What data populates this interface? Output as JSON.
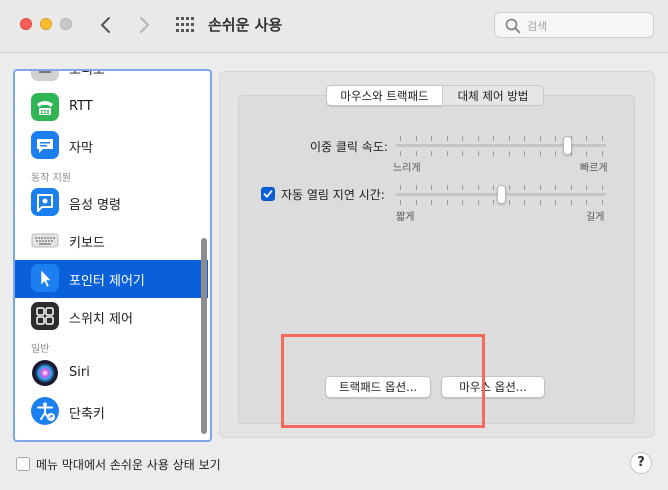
{
  "window": {
    "title": "손쉬운 사용"
  },
  "search": {
    "placeholder": "검색"
  },
  "sidebar": {
    "partial_top_label": "오디오",
    "items": [
      {
        "label": "RTT",
        "icon": "rtt-phone-icon",
        "color": "#2fb553"
      },
      {
        "label": "자막",
        "icon": "captions-icon",
        "color": "#1c7ff0"
      },
      {
        "header": "동작 지원"
      },
      {
        "label": "음성 명령",
        "icon": "voice-control-icon",
        "color": "#1c7ff0"
      },
      {
        "label": "키보드",
        "icon": "keyboard-icon",
        "color": "#d9d9d9"
      },
      {
        "label": "포인터 제어기",
        "icon": "pointer-control-icon",
        "color": "#1c7ff0",
        "selected": true
      },
      {
        "label": "스위치 제어",
        "icon": "switch-control-icon",
        "color": "#2c2c2e"
      },
      {
        "header": "일반"
      },
      {
        "label": "Siri",
        "icon": "siri-icon",
        "color": "#1a1a2e"
      },
      {
        "label": "단축키",
        "icon": "accessibility-shortcut-icon",
        "color": "#1c7ff0"
      }
    ]
  },
  "tabs": [
    {
      "label": "마우스와 트랙패드",
      "active": true
    },
    {
      "label": "대체 제어 방법",
      "active": false
    }
  ],
  "settings": {
    "double_click": {
      "label": "이중 클릭 속도:",
      "min_label": "느리게",
      "max_label": "빠르게",
      "value": 0.83
    },
    "spring_loading": {
      "label": "자동 열림 지연 시간:",
      "checked": true,
      "min_label": "짧게",
      "max_label": "길게",
      "value": 0.5
    }
  },
  "buttons": {
    "trackpad_options": "트랙패드 옵션...",
    "mouse_options": "마우스 옵션..."
  },
  "footer": {
    "menu_bar_status_label": "메뉴 막대에서 손쉬운 사용 상태 보기",
    "menu_bar_status_checked": false,
    "help": "?"
  },
  "colors": {
    "accent": "#0a60d8",
    "highlight_box": "#f4695b"
  }
}
